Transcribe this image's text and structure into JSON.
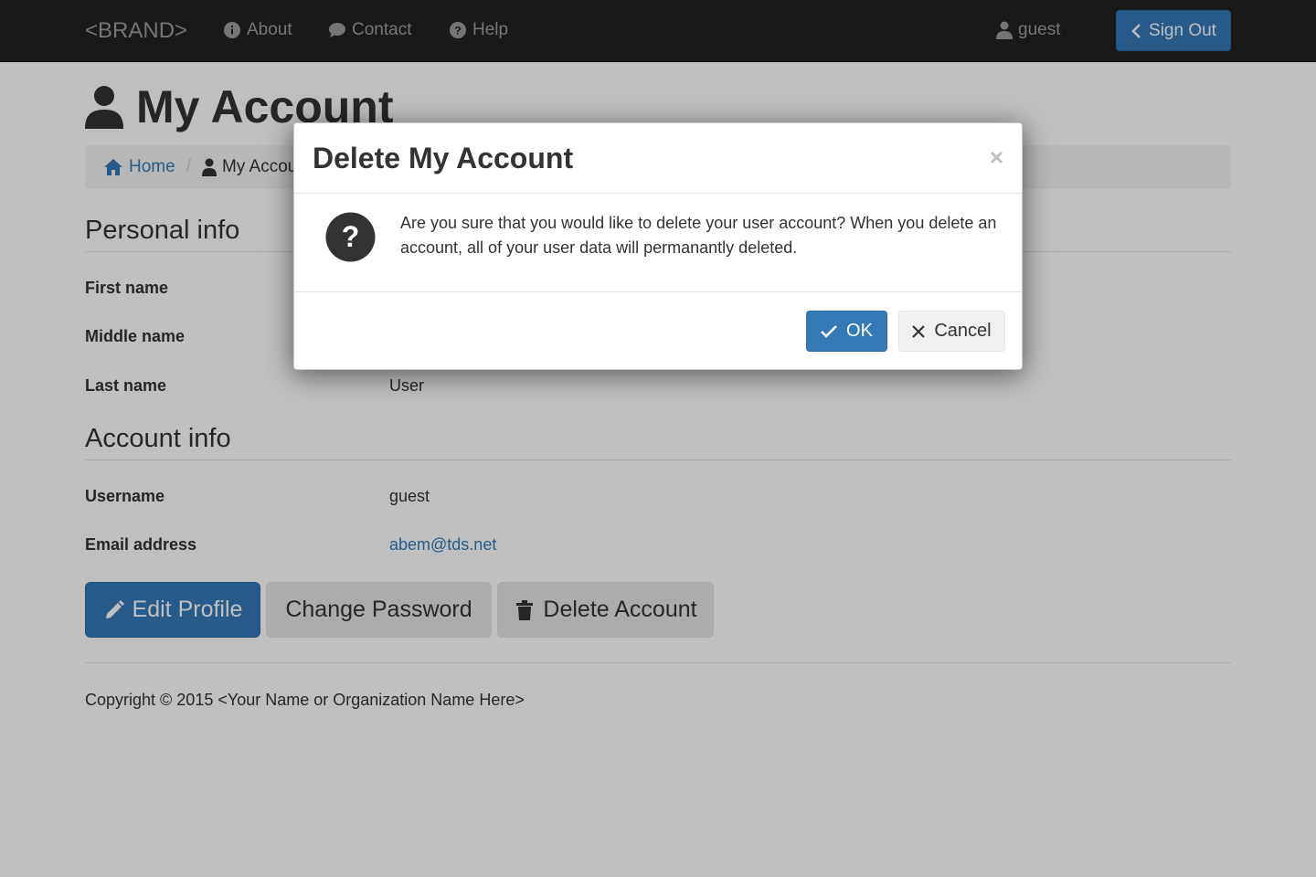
{
  "navbar": {
    "brand": "<BRAND>",
    "links": [
      {
        "label": "About",
        "icon": "info-circle-icon"
      },
      {
        "label": "Contact",
        "icon": "comment-icon"
      },
      {
        "label": "Help",
        "icon": "question-circle-icon"
      }
    ],
    "user": "guest",
    "sign_out": "Sign Out"
  },
  "page": {
    "title": "My Account",
    "breadcrumb": {
      "home": "Home",
      "current": "My Account"
    },
    "personal_info": {
      "heading": "Personal info",
      "fields": [
        {
          "label": "First name",
          "value": ""
        },
        {
          "label": "Middle name",
          "value": ""
        },
        {
          "label": "Last name",
          "value": "User"
        }
      ]
    },
    "account_info": {
      "heading": "Account info",
      "fields": [
        {
          "label": "Username",
          "value": "guest"
        },
        {
          "label": "Email address",
          "value": "abem@tds.net"
        }
      ]
    },
    "buttons": {
      "edit_profile": "Edit Profile",
      "change_password": "Change Password",
      "delete_account": "Delete Account"
    },
    "footer": {
      "copyright": "Copyright © 2015 <Your Name or Organization Name Here>"
    }
  },
  "modal": {
    "title": "Delete My Account",
    "close": "×",
    "message": "Are you sure that you would like to delete your user account? When you delete an account, all of your user data will permanantly deleted.",
    "ok": "OK",
    "cancel": "Cancel"
  },
  "colors": {
    "primary": "#337ab7",
    "navbar": "#222222",
    "backdrop": "rgba(0,0,0,0.25)"
  }
}
